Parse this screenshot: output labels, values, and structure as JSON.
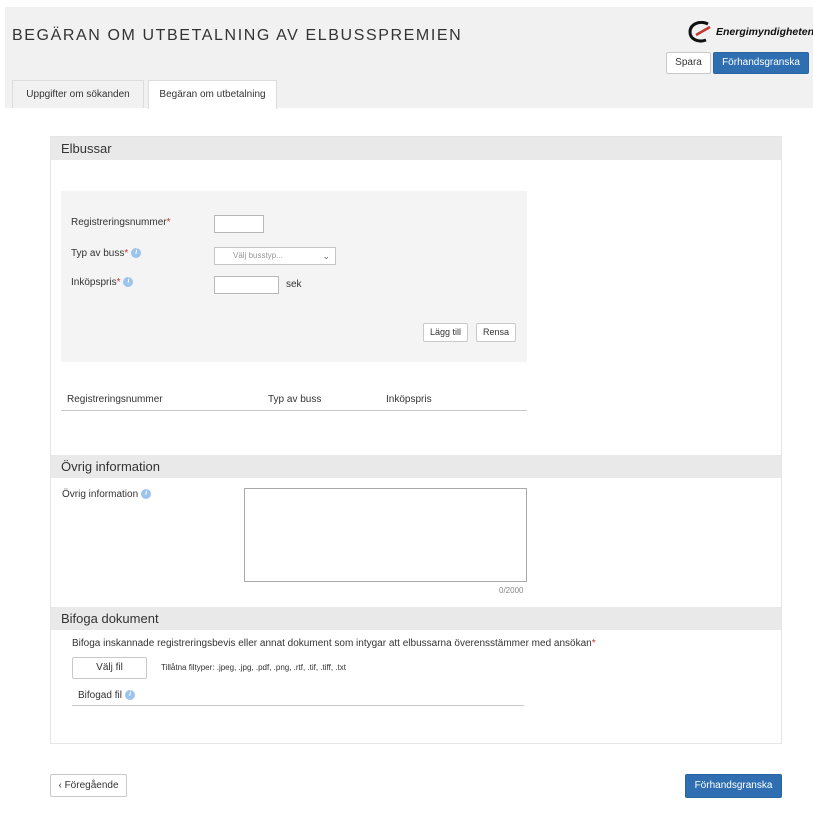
{
  "header": {
    "title": "BEGÄRAN OM UTBETALNING AV ELBUSSPREMIEN",
    "logo_text": "Energimyndigheten",
    "save_label": "Spara",
    "preview_label": "Förhandsgranska"
  },
  "tabs": [
    {
      "label": "Uppgifter om sökanden",
      "active": false
    },
    {
      "label": "Begäran om utbetalning",
      "active": true
    }
  ],
  "elbussar": {
    "heading": "Elbussar",
    "reg_label": "Registreringsnummer",
    "type_label": "Typ av buss",
    "price_label": "Inköpspris",
    "required_mark": "*",
    "info_glyph": "i",
    "type_placeholder": "Välj busstyp...",
    "currency": "sek",
    "add_label": "Lägg till",
    "clear_label": "Rensa",
    "table_headers": [
      "Registreringsnummer",
      "Typ av buss",
      "Inköpspris"
    ],
    "table_rows": []
  },
  "other": {
    "heading": "Övrig information",
    "label": "Övrig information",
    "char_count": "0/2000"
  },
  "attach": {
    "heading": "Bifoga dokument",
    "instruction": "Bifoga inskannade registreringsbevis eller annat dokument som intygar att elbussarna överensstämmer med ansökan",
    "choose_file": "Välj fil",
    "allowed_types": "Tillåtna filtyper: .jpeg, .jpg, .pdf, .png, .rtf, .tif, .tiff, .txt",
    "attached_label": "Bifogad fil"
  },
  "footer": {
    "prev_label": "‹ Föregående",
    "preview_label": "Förhandsgranska"
  },
  "colors": {
    "primary": "#2f6fb1",
    "required": "#c0392b",
    "info_icon": "#9cc3ec",
    "section_bg": "#e9e9e9"
  }
}
